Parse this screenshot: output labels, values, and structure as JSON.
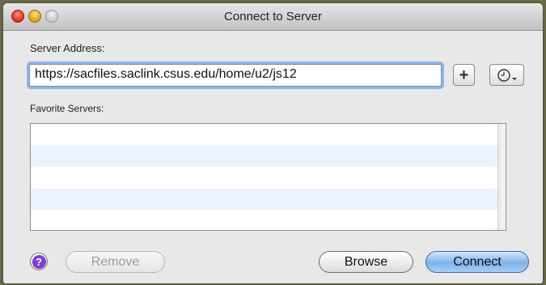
{
  "window": {
    "title": "Connect to Server"
  },
  "server_address": {
    "label": "Server Address:",
    "value": "https://sacfiles.saclink.csus.edu/home/u2/js12"
  },
  "favorites": {
    "label": "Favorite Servers:",
    "items": []
  },
  "buttons": {
    "add": "+",
    "help": "?",
    "remove": "Remove",
    "browse": "Browse",
    "connect": "Connect"
  },
  "icons": {
    "close": "close-dot-icon",
    "minimize": "minimize-dot-icon",
    "zoom": "zoom-dot-icon",
    "recent": "clock-dropdown-icon",
    "help": "question-icon"
  },
  "colors": {
    "focus_ring": "#8fb4e8",
    "default_button": "#7fb2ea",
    "help_icon": "#7b3fd1",
    "list_stripe": "#edf3fe"
  }
}
